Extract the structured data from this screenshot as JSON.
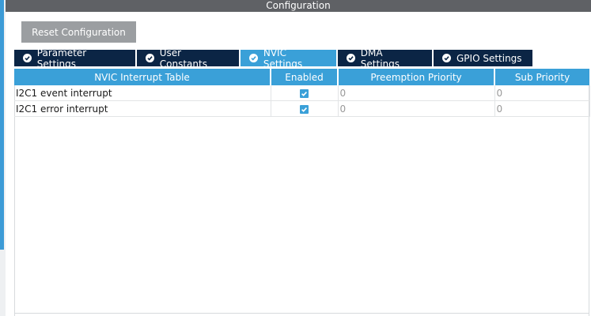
{
  "window": {
    "title": "Configuration"
  },
  "toolbar": {
    "reset_label": "Reset Configuration"
  },
  "tabs": [
    {
      "label": "Parameter Settings",
      "active": false,
      "icon": "check-circle-icon"
    },
    {
      "label": "User Constants",
      "active": false,
      "icon": "check-circle-icon"
    },
    {
      "label": "NVIC Settings",
      "active": true,
      "icon": "check-circle-icon"
    },
    {
      "label": "DMA Settings",
      "active": false,
      "icon": "check-circle-icon"
    },
    {
      "label": "GPIO Settings",
      "active": false,
      "icon": "check-circle-icon"
    }
  ],
  "table": {
    "columns": [
      "NVIC Interrupt Table",
      "Enabled",
      "Preemption Priority",
      "Sub Priority"
    ],
    "rows": [
      {
        "name": "I2C1 event interrupt",
        "enabled": true,
        "preemption": "0",
        "sub": "0"
      },
      {
        "name": "I2C1 error interrupt",
        "enabled": true,
        "preemption": "0",
        "sub": "0"
      }
    ]
  },
  "colors": {
    "accent": "#3aa0d8",
    "tab_dark": "#0b2545",
    "title_bar": "#5f6165",
    "button": "#9b9ea1"
  }
}
